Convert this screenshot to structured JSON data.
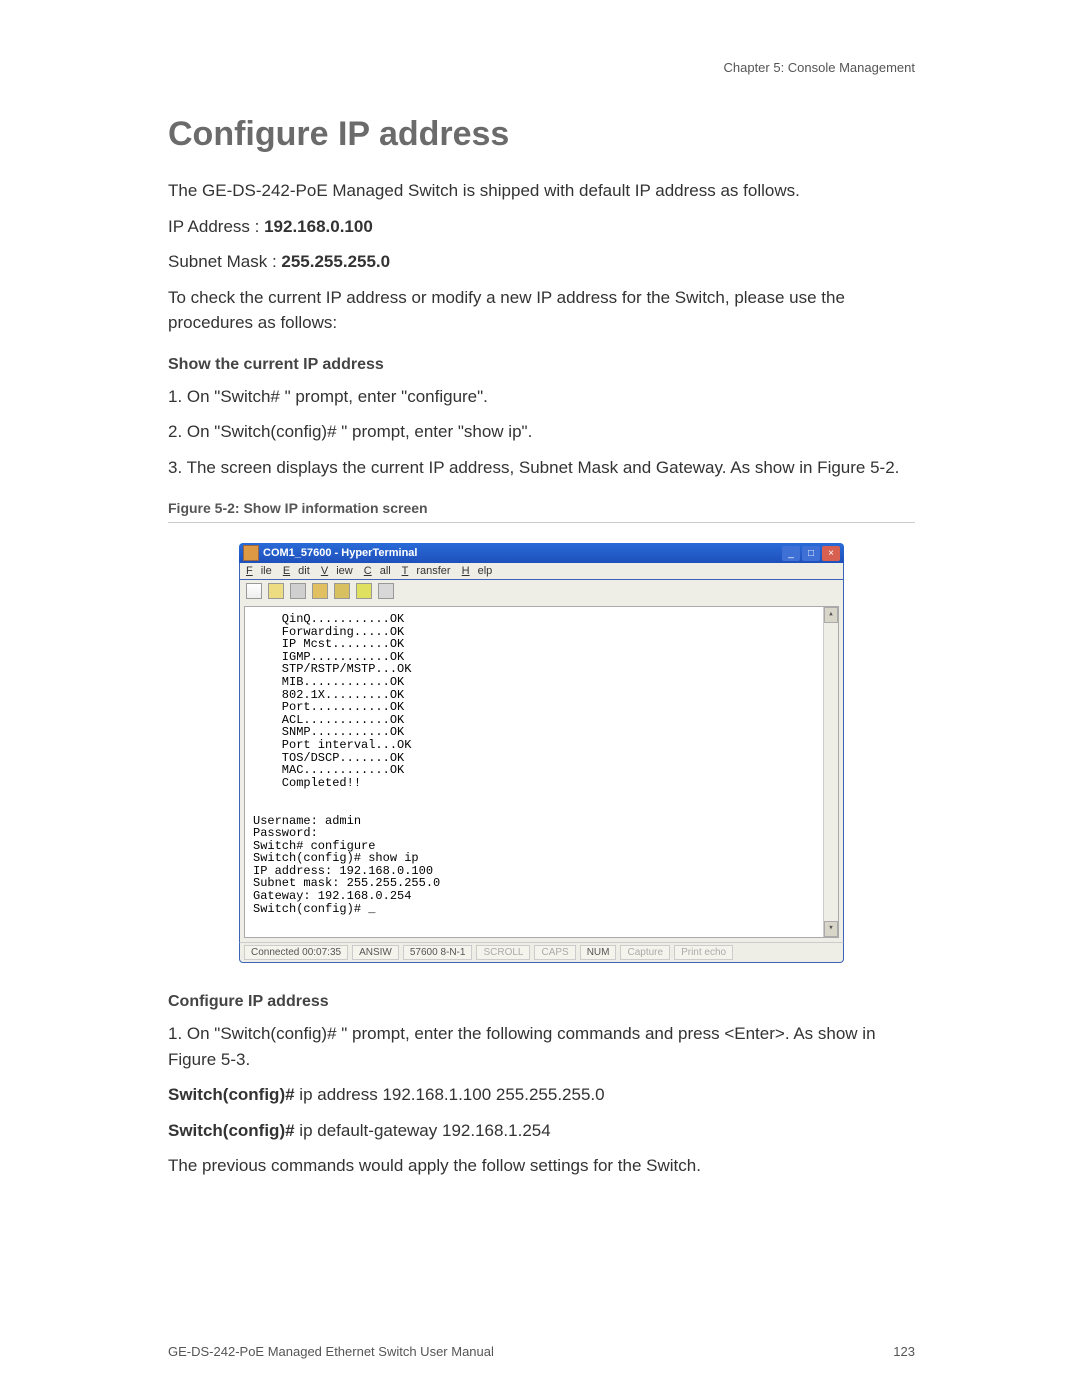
{
  "chapter": "Chapter 5: Console Management",
  "title": "Configure IP address",
  "intro": "The GE-DS-242-PoE Managed Switch is shipped with default IP address as follows.",
  "ip_label": "IP Address : ",
  "ip_value": "192.168.0.100",
  "mask_label": "Subnet Mask : ",
  "mask_value": "255.255.255.0",
  "para_check": "To check the current IP address or modify a new IP address for the Switch, please use the procedures as follows:",
  "show_heading": "Show the current IP address",
  "step1": "1. On \"Switch# \" prompt, enter \"configure\".",
  "step2": "2. On \"Switch(config)# \" prompt, enter \"show ip\".",
  "step3": "3. The screen displays the current IP address, Subnet Mask and Gateway. As show in Figure 5-2.",
  "fig_caption": "Figure 5-2: Show IP information screen",
  "terminal": {
    "title": "COM1_57600 - HyperTerminal",
    "menu": {
      "file": "File",
      "edit": "Edit",
      "view": "View",
      "call": "Call",
      "transfer": "Transfer",
      "help": "Help"
    },
    "console_text": "    QinQ...........OK\n    Forwarding.....OK\n    IP Mcst........OK\n    IGMP...........OK\n    STP/RSTP/MSTP...OK\n    MIB............OK\n    802.1X.........OK\n    Port...........OK\n    ACL............OK\n    SNMP...........OK\n    Port interval...OK\n    TOS/DSCP.......OK\n    MAC............OK\n    Completed!!\n\n\nUsername: admin\nPassword:\nSwitch# configure\nSwitch(config)# show ip\nIP address: 192.168.0.100\nSubnet mask: 255.255.255.0\nGateway: 192.168.0.254\nSwitch(config)# _",
    "status": {
      "connected": "Connected 00:07:35",
      "term": "ANSIW",
      "baud": "57600 8-N-1",
      "scroll": "SCROLL",
      "caps": "CAPS",
      "num": "NUM",
      "capture": "Capture",
      "echo": "Print echo"
    }
  },
  "config_heading": "Configure IP address",
  "config_step1": "1. On \"Switch(config)# \" prompt, enter the following commands and press <Enter>. As show in Figure 5-3.",
  "cmd1_prefix": "Switch(config)#",
  "cmd1_rest": " ip address 192.168.1.100 255.255.255.0",
  "cmd2_prefix": "Switch(config)#",
  "cmd2_rest": " ip default-gateway 192.168.1.254",
  "outro": "The previous commands would apply the follow settings for the Switch.",
  "footer_left": "GE-DS-242-PoE Managed Ethernet Switch User Manual",
  "footer_right": "123"
}
